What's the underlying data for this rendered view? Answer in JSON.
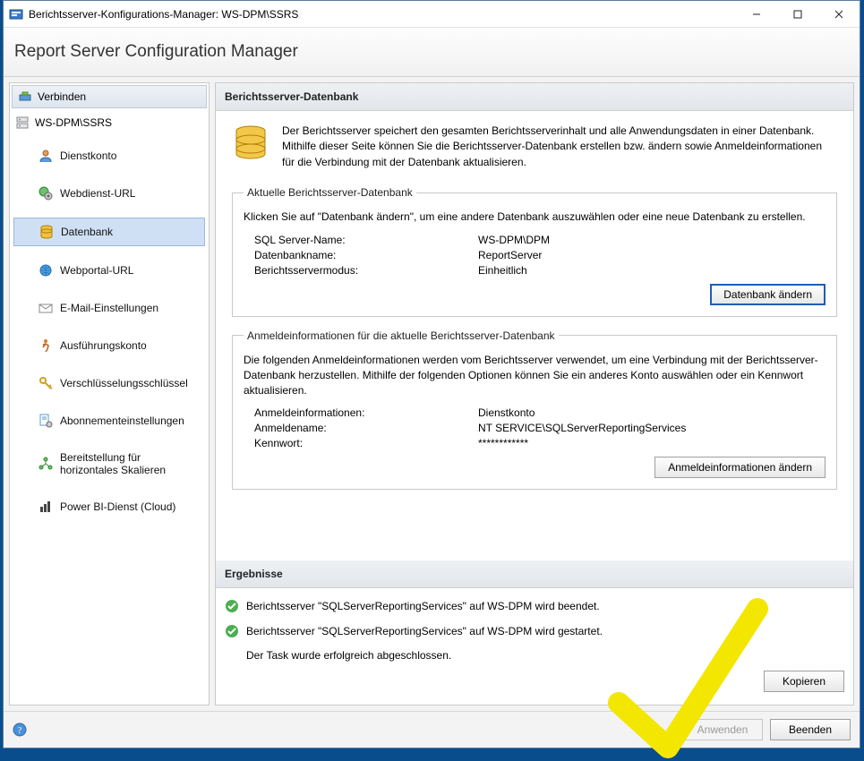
{
  "window": {
    "title": "Berichtsserver-Konfigurations-Manager: WS-DPM\\SSRS"
  },
  "header": {
    "title": "Report Server Configuration Manager"
  },
  "sidebar": {
    "connect_label": "Verbinden",
    "server_node": "WS-DPM\\SSRS",
    "items": [
      {
        "label": "Dienstkonto"
      },
      {
        "label": "Webdienst-URL"
      },
      {
        "label": "Datenbank"
      },
      {
        "label": "Webportal-URL"
      },
      {
        "label": "E-Mail-Einstellungen"
      },
      {
        "label": "Ausführungskonto"
      },
      {
        "label": "Verschlüsselungsschlüssel"
      },
      {
        "label": "Abonnementeinstellungen"
      },
      {
        "label": "Bereitstellung für horizontales Skalieren"
      },
      {
        "label": "Power BI-Dienst (Cloud)"
      }
    ]
  },
  "main": {
    "section_title": "Berichtsserver-Datenbank",
    "intro": "Der Berichtsserver speichert den gesamten Berichtsserverinhalt und alle Anwendungsdaten in einer Datenbank. Mithilfe dieser Seite können Sie die Berichtsserver-Datenbank erstellen bzw. ändern sowie Anmeldeinformationen für die Verbindung mit der Datenbank aktualisieren.",
    "current_db": {
      "legend": "Aktuelle Berichtsserver-Datenbank",
      "desc": "Klicken Sie auf \"Datenbank ändern\", um eine andere Datenbank auszuwählen oder eine neue Datenbank zu erstellen.",
      "sql_server_label": "SQL Server-Name:",
      "sql_server_value": "WS-DPM\\DPM",
      "dbname_label": "Datenbankname:",
      "dbname_value": "ReportServer",
      "mode_label": "Berichtsservermodus:",
      "mode_value": "Einheitlich",
      "change_btn": "Datenbank ändern"
    },
    "creds": {
      "legend": "Anmeldeinformationen für die aktuelle Berichtsserver-Datenbank",
      "desc": "Die folgenden Anmeldeinformationen werden vom Berichtsserver verwendet, um eine Verbindung mit der Berichtsserver-Datenbank herzustellen. Mithilfe der folgenden Optionen können Sie ein anderes Konto auswählen oder ein Kennwort aktualisieren.",
      "cred_label": "Anmeldeinformationen:",
      "cred_value": "Dienstkonto",
      "login_label": "Anmeldename:",
      "login_value": "NT SERVICE\\SQLServerReportingServices",
      "pw_label": "Kennwort:",
      "pw_value": "************",
      "change_btn": "Anmeldeinformationen ändern"
    }
  },
  "results": {
    "header": "Ergebnisse",
    "line1": "Berichtsserver \"SQLServerReportingServices\" auf WS-DPM wird beendet.",
    "line2": "Berichtsserver \"SQLServerReportingServices\" auf WS-DPM wird gestartet.",
    "final": "Der Task wurde erfolgreich abgeschlossen.",
    "copy_btn": "Kopieren"
  },
  "footer": {
    "apply": "Anwenden",
    "exit": "Beenden"
  }
}
